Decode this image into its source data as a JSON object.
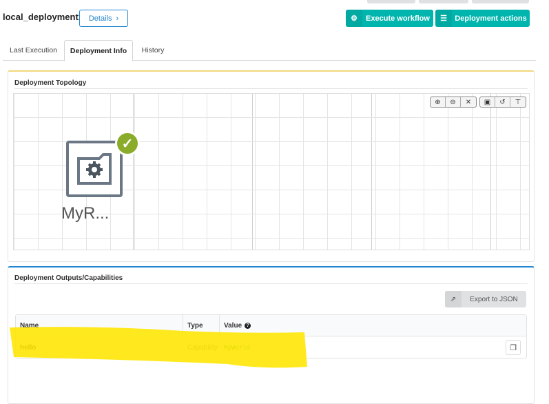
{
  "header": {
    "title": "local_deployment1",
    "details_label": "Details",
    "execute_label": "Execute workflow",
    "actions_label": "Deployment actions"
  },
  "tabs": [
    {
      "label": "Last Execution"
    },
    {
      "label": "Deployment Info",
      "active": true
    },
    {
      "label": "History"
    }
  ],
  "topology": {
    "title": "Deployment Topology",
    "node": {
      "label": "MyR...",
      "status": "ok"
    },
    "toolbar": [
      "zoom-in-icon",
      "zoom-out-icon",
      "fit-icon",
      "save-icon",
      "reset-icon",
      "layout-icon"
    ]
  },
  "outputs": {
    "title": "Deployment Outputs/Capabilities",
    "export_label": "Export to JSON",
    "columns": [
      "Name",
      "Type",
      "Value"
    ],
    "rows": [
      {
        "name": "hello",
        "type": "Capability",
        "value": "MyWorld"
      }
    ]
  },
  "colors": {
    "accent": "#00b5ad",
    "status_ok": "#8bac2a",
    "highlight": "#ffe600"
  }
}
